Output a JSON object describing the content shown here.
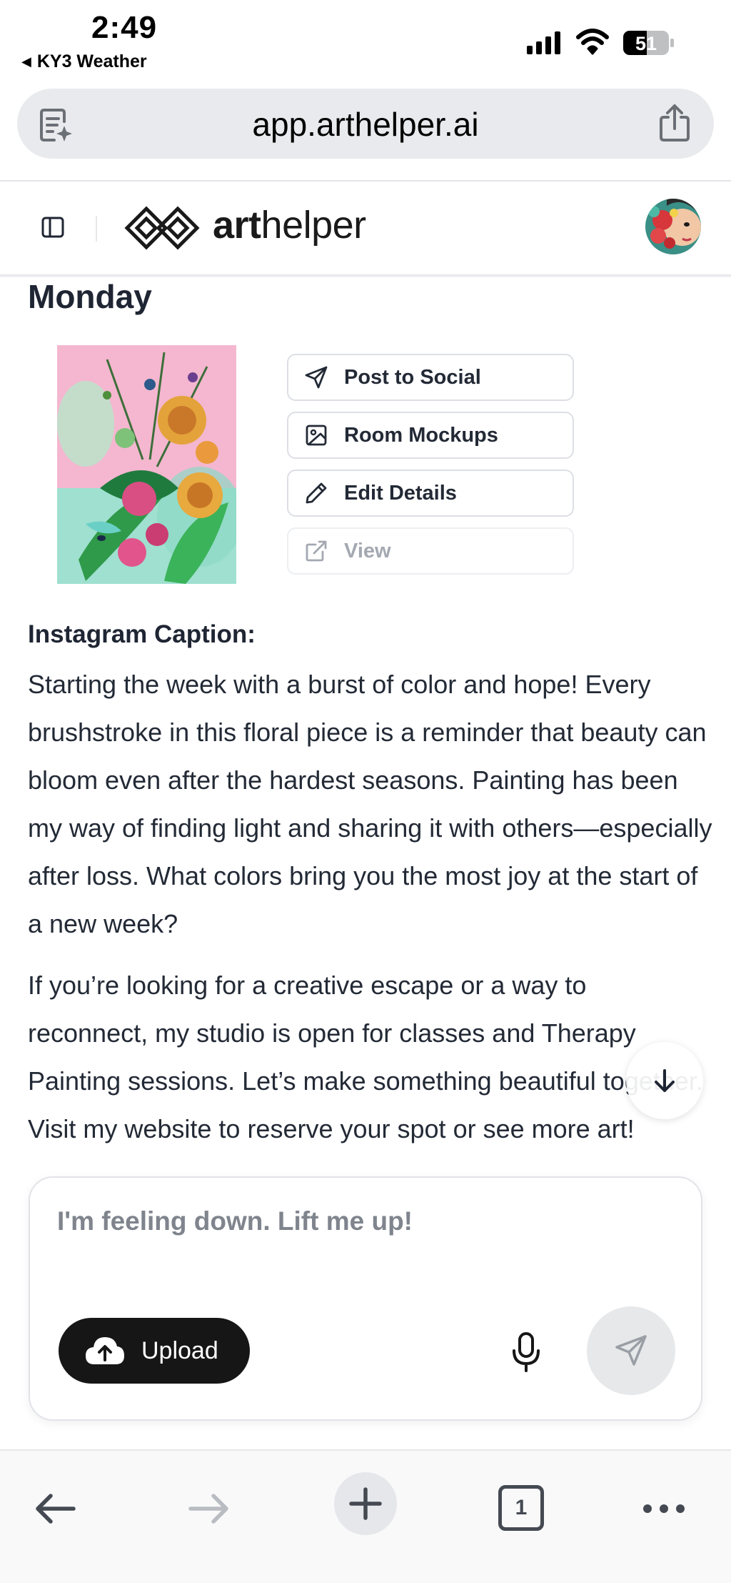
{
  "status_bar": {
    "time": "2:49",
    "back_app": "KY3 Weather",
    "battery": "51"
  },
  "browser": {
    "url": "app.arthelper.ai"
  },
  "header": {
    "logo_bold": "art",
    "logo_rest": "helper"
  },
  "content": {
    "day": "Monday",
    "actions": [
      {
        "label": "Post to Social",
        "icon": "send-icon",
        "enabled": true
      },
      {
        "label": "Room Mockups",
        "icon": "image-icon",
        "enabled": true
      },
      {
        "label": "Edit Details",
        "icon": "pencil-icon",
        "enabled": true
      },
      {
        "label": "View",
        "icon": "external-link-icon",
        "enabled": false
      }
    ],
    "caption_heading": "Instagram Caption:",
    "paragraph1": "Starting the week with a burst of color and hope! Every brushstroke in this floral piece is a reminder that beauty can bloom even after the hardest seasons. Painting has been my way of finding light and sharing it with others—especially after loss. What colors bring you the most joy at the start of a new week?",
    "paragraph2": "If you’re looking for a creative escape or a way to reconnect, my studio is open for classes and Therapy Painting sessions. Let’s make something beautiful together. Visit my website to reserve your spot or see more art!"
  },
  "chat": {
    "placeholder": "I'm feeling down. Lift me up!",
    "upload_label": "Upload"
  },
  "toolbar": {
    "tab_count": "1"
  },
  "colors": {
    "text_dark": "#1f2533",
    "upload_bg": "#161616",
    "url_bar_bg": "#e9eaed"
  }
}
